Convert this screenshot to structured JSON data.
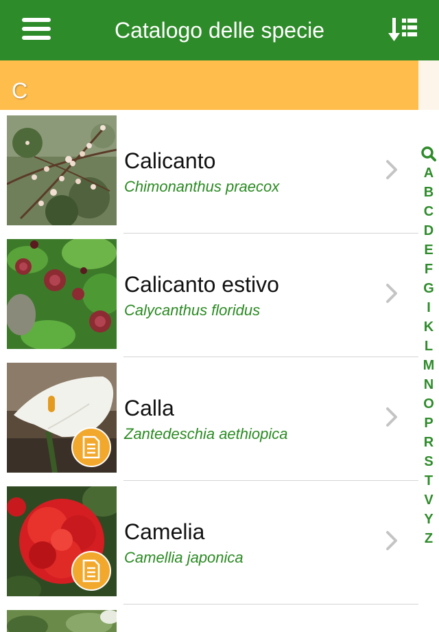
{
  "navbar": {
    "title": "Catalogo delle specie",
    "menu_icon": "hamburger-menu-icon",
    "sort_icon": "sort-list-icon",
    "background_color": "#2e8b2a"
  },
  "section": {
    "letter": "C",
    "background_color": "#ffbd4c"
  },
  "species": [
    {
      "common_name": "Calicanto",
      "latin_name": "Chimonanthus praecox",
      "has_sheet": false
    },
    {
      "common_name": "Calicanto estivo",
      "latin_name": "Calycanthus floridus",
      "has_sheet": false
    },
    {
      "common_name": "Calla",
      "latin_name": "Zantedeschia aethiopica",
      "has_sheet": true
    },
    {
      "common_name": "Camelia",
      "latin_name": "Camellia japonica",
      "has_sheet": true
    }
  ],
  "index": {
    "search_icon": "search-icon",
    "letters": [
      "A",
      "B",
      "C",
      "D",
      "E",
      "F",
      "G",
      "I",
      "K",
      "L",
      "M",
      "N",
      "O",
      "P",
      "R",
      "S",
      "T",
      "V",
      "Y",
      "Z"
    ]
  },
  "colors": {
    "accent_green": "#2e8b2a",
    "latin_text": "#2a8a22",
    "badge_orange": "#f2a82c"
  }
}
